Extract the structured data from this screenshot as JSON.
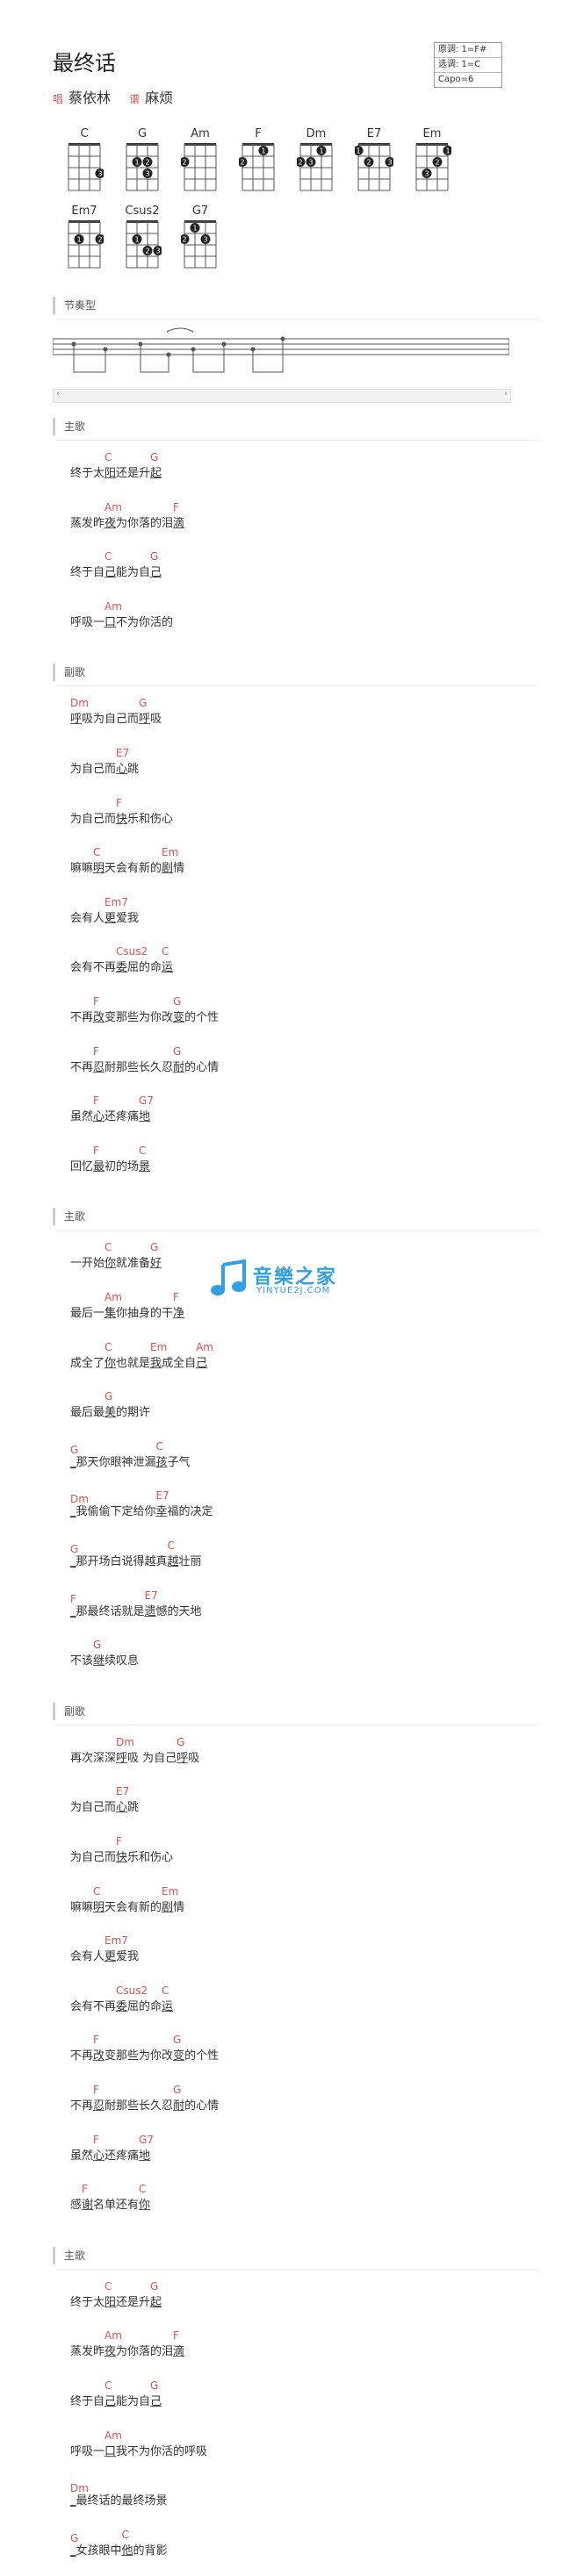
{
  "title": "最终话",
  "singer_label": "唱",
  "singer": "蔡依林",
  "arranger_label": "谱",
  "arranger": "麻烦",
  "key_box": [
    "原调: 1=F#",
    "选调: 1=C",
    "Capo=6"
  ],
  "chords": [
    {
      "name": "C",
      "dots": [
        {
          "s": 4,
          "f": 3,
          "n": "3"
        }
      ]
    },
    {
      "name": "G",
      "dots": [
        {
          "s": 2,
          "f": 2,
          "n": "1"
        },
        {
          "s": 3,
          "f": 2,
          "n": "2"
        },
        {
          "s": 3,
          "f": 3,
          "n": "3"
        }
      ]
    },
    {
      "name": "Am",
      "dots": [
        {
          "s": 1,
          "f": 2,
          "n": "2"
        }
      ]
    },
    {
      "name": "F",
      "dots": [
        {
          "s": 1,
          "f": 2,
          "n": "2"
        },
        {
          "s": 3,
          "f": 1,
          "n": "1"
        }
      ]
    },
    {
      "name": "Dm",
      "dots": [
        {
          "s": 1,
          "f": 2,
          "n": "2"
        },
        {
          "s": 2,
          "f": 2,
          "n": "3"
        },
        {
          "s": 3,
          "f": 1,
          "n": "1"
        }
      ]
    },
    {
      "name": "E7",
      "dots": [
        {
          "s": 1,
          "f": 1,
          "n": "1"
        },
        {
          "s": 2,
          "f": 2,
          "n": "2"
        },
        {
          "s": 4,
          "f": 2,
          "n": "3"
        }
      ]
    },
    {
      "name": "Em",
      "dots": [
        {
          "s": 2,
          "f": 3,
          "n": "3"
        },
        {
          "s": 3,
          "f": 2,
          "n": "2"
        },
        {
          "s": 4,
          "f": 1,
          "n": "1"
        }
      ]
    },
    {
      "name": "Em7",
      "dots": [
        {
          "s": 2,
          "f": 2,
          "n": "1"
        },
        {
          "s": 4,
          "f": 2,
          "n": "2"
        }
      ]
    },
    {
      "name": "Csus2",
      "dots": [
        {
          "s": 2,
          "f": 2,
          "n": "1"
        },
        {
          "s": 3,
          "f": 3,
          "n": "2"
        },
        {
          "s": 4,
          "f": 3,
          "n": "3"
        }
      ]
    },
    {
      "name": "G7",
      "dots": [
        {
          "s": 2,
          "f": 1,
          "n": "1"
        },
        {
          "s": 1,
          "f": 2,
          "n": "2"
        },
        {
          "s": 3,
          "f": 2,
          "n": "3"
        }
      ]
    }
  ],
  "rhythm_label": "节奏型",
  "sections": [
    {
      "label": "主歌",
      "lines": [
        [
          {
            "c": "",
            "t": "终于太"
          },
          {
            "c": "C",
            "t": "阳"
          },
          {
            "c": "",
            "t": "还是升"
          },
          {
            "c": "G",
            "t": "起"
          }
        ],
        [
          {
            "c": "",
            "t": "蒸发昨"
          },
          {
            "c": "Am",
            "t": "夜"
          },
          {
            "c": "",
            "t": "为你落的泪"
          },
          {
            "c": "F",
            "t": "滴"
          }
        ],
        [
          {
            "c": "",
            "t": "终于自"
          },
          {
            "c": "C",
            "t": "己"
          },
          {
            "c": "",
            "t": "能为自"
          },
          {
            "c": "G",
            "t": "己"
          }
        ],
        [
          {
            "c": "",
            "t": "呼吸一"
          },
          {
            "c": "Am",
            "t": "口"
          },
          {
            "c": "",
            "t": "不为你活的"
          }
        ]
      ]
    },
    {
      "label": "副歌",
      "lines": [
        [
          {
            "c": "Dm",
            "t": "呼"
          },
          {
            "c": "",
            "t": "吸为自己而"
          },
          {
            "c": "G",
            "t": "呼"
          },
          {
            "c": "",
            "t": "吸"
          }
        ],
        [
          {
            "c": "",
            "t": "为自己而"
          },
          {
            "c": "E7",
            "t": "心"
          },
          {
            "c": "",
            "t": "跳"
          }
        ],
        [
          {
            "c": "",
            "t": "为自己而"
          },
          {
            "c": "F",
            "t": "快"
          },
          {
            "c": "",
            "t": "乐和伤心"
          }
        ],
        [
          {
            "c": "",
            "t": "嘛嘛"
          },
          {
            "c": "C",
            "t": "明"
          },
          {
            "c": "",
            "t": "天会有新的"
          },
          {
            "c": "Em",
            "t": "剧"
          },
          {
            "c": "",
            "t": "情"
          }
        ],
        [
          {
            "c": "",
            "t": "会有人"
          },
          {
            "c": "Em7",
            "t": "更"
          },
          {
            "c": "",
            "t": "爱我"
          }
        ],
        [
          {
            "c": "",
            "t": "会有不再"
          },
          {
            "c": "Csus2",
            "t": "委"
          },
          {
            "c": "",
            "t": "屈的命"
          },
          {
            "c": "C",
            "t": "运"
          }
        ],
        [
          {
            "c": "",
            "t": "不再"
          },
          {
            "c": "F",
            "t": "改"
          },
          {
            "c": "",
            "t": "变那些为你改"
          },
          {
            "c": "G",
            "t": "变"
          },
          {
            "c": "",
            "t": "的个性"
          }
        ],
        [
          {
            "c": "",
            "t": "不再"
          },
          {
            "c": "F",
            "t": "忍"
          },
          {
            "c": "",
            "t": "耐那些长久忍"
          },
          {
            "c": "G",
            "t": "耐"
          },
          {
            "c": "",
            "t": "的心情"
          }
        ],
        [
          {
            "c": "",
            "t": "虽然"
          },
          {
            "c": "F",
            "t": "心"
          },
          {
            "c": "",
            "t": "还疼痛"
          },
          {
            "c": "G7",
            "t": "地"
          }
        ],
        [
          {
            "c": "",
            "t": "回忆"
          },
          {
            "c": "F",
            "t": "最"
          },
          {
            "c": "",
            "t": "初的场"
          },
          {
            "c": "C",
            "t": "景"
          }
        ]
      ]
    },
    {
      "label": "主歌",
      "lines": [
        [
          {
            "c": "",
            "t": "一开始"
          },
          {
            "c": "C",
            "t": "你"
          },
          {
            "c": "",
            "t": "就准备"
          },
          {
            "c": "G",
            "t": "好"
          }
        ],
        [
          {
            "c": "",
            "t": "最后一"
          },
          {
            "c": "Am",
            "t": "集"
          },
          {
            "c": "",
            "t": "你抽身的干"
          },
          {
            "c": "F",
            "t": "净"
          }
        ],
        [
          {
            "c": "",
            "t": "成全了"
          },
          {
            "c": "C",
            "t": "你"
          },
          {
            "c": "",
            "t": "也就是"
          },
          {
            "c": "Em",
            "t": "我"
          },
          {
            "c": "",
            "t": " 成全自"
          },
          {
            "c": "Am",
            "t": "己"
          }
        ],
        [
          {
            "c": "",
            "t": "最后最"
          },
          {
            "c": "G",
            "t": "美"
          },
          {
            "c": "",
            "t": "的期许"
          }
        ],
        [
          {
            "c": "G",
            "t": "_"
          },
          {
            "c": "",
            "t": "那天你眼神泄漏"
          },
          {
            "c": "C",
            "t": "孩"
          },
          {
            "c": "",
            "t": "子气"
          }
        ],
        [
          {
            "c": "Dm",
            "t": "_"
          },
          {
            "c": "",
            "t": "我偷偷下定给你"
          },
          {
            "c": "E7",
            "t": "幸"
          },
          {
            "c": "",
            "t": "福的决定"
          }
        ],
        [
          {
            "c": "G",
            "t": "_"
          },
          {
            "c": "",
            "t": "那开场白说得越真"
          },
          {
            "c": "C",
            "t": "越"
          },
          {
            "c": "",
            "t": "壮丽"
          }
        ],
        [
          {
            "c": "F",
            "t": "_"
          },
          {
            "c": "",
            "t": "那最终话就是"
          },
          {
            "c": "E7",
            "t": "遗"
          },
          {
            "c": "",
            "t": "憾的天地"
          }
        ],
        [
          {
            "c": "",
            "t": "不该"
          },
          {
            "c": "G",
            "t": "继"
          },
          {
            "c": "",
            "t": "续叹息"
          }
        ]
      ]
    },
    {
      "label": "副歌",
      "lines": [
        [
          {
            "c": "",
            "t": "再次深深"
          },
          {
            "c": "Dm",
            "t": "呼"
          },
          {
            "c": "",
            "t": "吸 为自己"
          },
          {
            "c": "G",
            "t": "呼"
          },
          {
            "c": "",
            "t": "吸"
          }
        ],
        [
          {
            "c": "",
            "t": "为自己而"
          },
          {
            "c": "E7",
            "t": "心"
          },
          {
            "c": "",
            "t": "跳"
          }
        ],
        [
          {
            "c": "",
            "t": "为自己而"
          },
          {
            "c": "F",
            "t": "快"
          },
          {
            "c": "",
            "t": "乐和伤心"
          }
        ],
        [
          {
            "c": "",
            "t": "嘛嘛"
          },
          {
            "c": "C",
            "t": "明"
          },
          {
            "c": "",
            "t": "天会有新的"
          },
          {
            "c": "Em",
            "t": "剧"
          },
          {
            "c": "",
            "t": "情"
          }
        ],
        [
          {
            "c": "",
            "t": "会有人"
          },
          {
            "c": "Em7",
            "t": "更"
          },
          {
            "c": "",
            "t": "爱我"
          }
        ],
        [
          {
            "c": "",
            "t": "会有不再"
          },
          {
            "c": "Csus2",
            "t": "委"
          },
          {
            "c": "",
            "t": "屈的命"
          },
          {
            "c": "C",
            "t": "运"
          }
        ],
        [
          {
            "c": "",
            "t": "不再"
          },
          {
            "c": "F",
            "t": "改"
          },
          {
            "c": "",
            "t": "变那些为你改"
          },
          {
            "c": "G",
            "t": "变"
          },
          {
            "c": "",
            "t": "的个性"
          }
        ],
        [
          {
            "c": "",
            "t": "不再"
          },
          {
            "c": "F",
            "t": "忍"
          },
          {
            "c": "",
            "t": "耐那些长久忍"
          },
          {
            "c": "G",
            "t": "耐"
          },
          {
            "c": "",
            "t": "的心情"
          }
        ],
        [
          {
            "c": "",
            "t": "虽然"
          },
          {
            "c": "F",
            "t": "心"
          },
          {
            "c": "",
            "t": "还疼痛"
          },
          {
            "c": "G7",
            "t": "地"
          }
        ],
        [
          {
            "c": "",
            "t": "感"
          },
          {
            "c": "F",
            "t": "谢"
          },
          {
            "c": "",
            "t": "名单还有"
          },
          {
            "c": "C",
            "t": "你"
          }
        ]
      ]
    },
    {
      "label": "主歌",
      "lines": [
        [
          {
            "c": "",
            "t": "终于太"
          },
          {
            "c": "C",
            "t": "阳"
          },
          {
            "c": "",
            "t": "还是升"
          },
          {
            "c": "G",
            "t": "起"
          }
        ],
        [
          {
            "c": "",
            "t": "蒸发昨"
          },
          {
            "c": "Am",
            "t": "夜"
          },
          {
            "c": "",
            "t": "为你落的泪"
          },
          {
            "c": "F",
            "t": "滴"
          }
        ],
        [
          {
            "c": "",
            "t": "终于自"
          },
          {
            "c": "C",
            "t": "己"
          },
          {
            "c": "",
            "t": "能为自"
          },
          {
            "c": "G",
            "t": "己"
          }
        ],
        [
          {
            "c": "",
            "t": "呼吸一"
          },
          {
            "c": "Am",
            "t": "口"
          },
          {
            "c": "",
            "t": " 我不为你活的呼吸"
          }
        ],
        [
          {
            "c": "Dm",
            "t": "_"
          },
          {
            "c": "",
            "t": "最终话的最终场景"
          }
        ],
        [
          {
            "c": "G",
            "t": "_"
          },
          {
            "c": "",
            "t": "女孩眼中"
          },
          {
            "c": "C",
            "t": "他"
          },
          {
            "c": "",
            "t": "的背影"
          }
        ]
      ]
    }
  ],
  "logo": {
    "main": "音樂之家",
    "sub": "YINYUE2J.COM"
  }
}
